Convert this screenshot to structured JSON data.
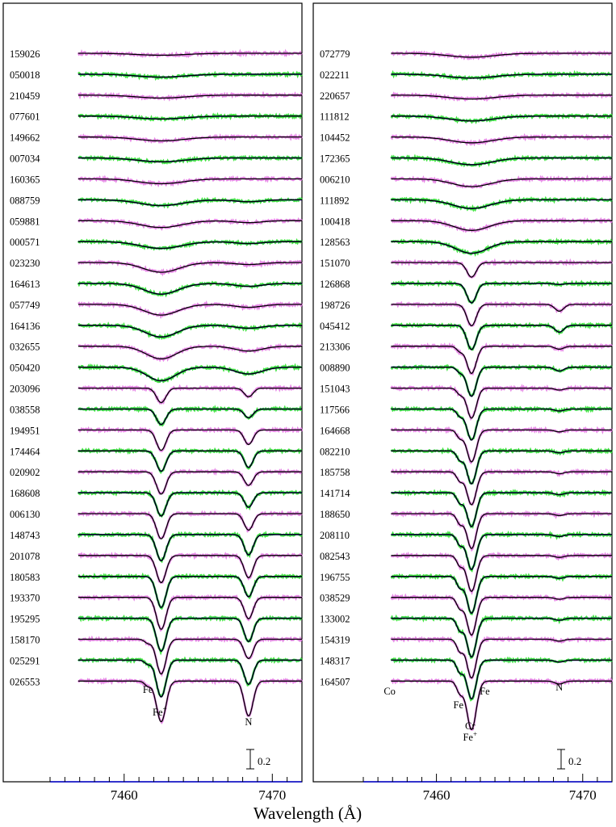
{
  "figure": {
    "xlabel": "Wavelength (Å)",
    "scale_bar_label": "0.2"
  },
  "series_colors": {
    "model": "#000000",
    "model_alt": "#1020c0",
    "observed_a": "#e27ae2",
    "observed_b": "#2ee02e",
    "masked": "#a0a0a0"
  },
  "chart_data": [
    {
      "type": "line",
      "panel": "left",
      "x_range": [
        7455.0,
        7472.0
      ],
      "xticks": [
        7460,
        7470
      ],
      "xtick_labels": [
        "7460",
        "7470"
      ],
      "scale_bar": 0.2,
      "line_labels": [
        {
          "text": "Fe",
          "x": 7461.6
        },
        {
          "text": "Fe",
          "sup": "+",
          "x": 7462.4
        },
        {
          "text": "N",
          "x": 7468.4
        }
      ],
      "stars": [
        {
          "id": "159026",
          "depths": [
            0.0,
            0.02,
            0.0
          ]
        },
        {
          "id": "050018",
          "depths": [
            0.0,
            0.03,
            0.0
          ]
        },
        {
          "id": "210459",
          "depths": [
            0.0,
            0.03,
            0.0
          ]
        },
        {
          "id": "077601",
          "depths": [
            0.0,
            0.03,
            0.0
          ]
        },
        {
          "id": "149662",
          "depths": [
            0.0,
            0.04,
            0.0
          ]
        },
        {
          "id": "007034",
          "depths": [
            0.0,
            0.04,
            0.0
          ]
        },
        {
          "id": "160365",
          "depths": [
            0.0,
            0.05,
            0.0
          ]
        },
        {
          "id": "088759",
          "depths": [
            0.0,
            0.06,
            0.02
          ]
        },
        {
          "id": "059881",
          "depths": [
            0.0,
            0.07,
            0.02
          ]
        },
        {
          "id": "000571",
          "depths": [
            0.0,
            0.07,
            0.02
          ]
        },
        {
          "id": "023230",
          "depths": [
            0.0,
            0.1,
            0.02
          ]
        },
        {
          "id": "164613",
          "depths": [
            0.0,
            0.11,
            0.03
          ]
        },
        {
          "id": "057749",
          "depths": [
            0.0,
            0.11,
            0.03
          ]
        },
        {
          "id": "164136",
          "depths": [
            0.0,
            0.12,
            0.03
          ]
        },
        {
          "id": "032655",
          "depths": [
            0.0,
            0.13,
            0.05
          ]
        },
        {
          "id": "050420",
          "depths": [
            0.0,
            0.14,
            0.07
          ]
        },
        {
          "id": "203096",
          "depths": [
            0.0,
            0.15,
            0.09
          ]
        },
        {
          "id": "038558",
          "depths": [
            0.0,
            0.16,
            0.09
          ]
        },
        {
          "id": "194951",
          "depths": [
            0.0,
            0.21,
            0.15
          ]
        },
        {
          "id": "174464",
          "depths": [
            0.0,
            0.21,
            0.17
          ]
        },
        {
          "id": "020902",
          "depths": [
            0.0,
            0.23,
            0.14
          ]
        },
        {
          "id": "168608",
          "depths": [
            0.0,
            0.24,
            0.15
          ]
        },
        {
          "id": "006130",
          "depths": [
            0.0,
            0.26,
            0.17
          ]
        },
        {
          "id": "148743",
          "depths": [
            0.0,
            0.27,
            0.21
          ]
        },
        {
          "id": "201078",
          "depths": [
            0.0,
            0.28,
            0.23
          ]
        },
        {
          "id": "180583",
          "depths": [
            0.0,
            0.32,
            0.21
          ]
        },
        {
          "id": "193370",
          "depths": [
            0.0,
            0.33,
            0.22
          ]
        },
        {
          "id": "195295",
          "depths": [
            0.0,
            0.34,
            0.24
          ]
        },
        {
          "id": "158170",
          "depths": [
            0.04,
            0.36,
            0.2
          ]
        },
        {
          "id": "025291",
          "depths": [
            0.04,
            0.38,
            0.25
          ]
        },
        {
          "id": "026553",
          "depths": [
            0.05,
            0.42,
            0.36
          ]
        }
      ]
    },
    {
      "type": "line",
      "panel": "right",
      "x_range": [
        7455.0,
        7472.0
      ],
      "xticks": [
        7460,
        7470
      ],
      "xtick_labels": [
        "7460",
        "7470"
      ],
      "scale_bar": 0.2,
      "line_labels": [
        {
          "text": "Co",
          "x": 7456.8
        },
        {
          "text": "Fe",
          "x": 7461.5
        },
        {
          "text": "Cr",
          "x": 7462.3
        },
        {
          "text": "Fe",
          "sup": "+",
          "x": 7462.3
        },
        {
          "text": "Fe",
          "x": 7463.3
        },
        {
          "text": "N",
          "x": 7468.4
        }
      ],
      "stars": [
        {
          "id": "072779",
          "depths": [
            0.0,
            0.04,
            0.0
          ]
        },
        {
          "id": "022211",
          "depths": [
            0.0,
            0.04,
            0.0
          ]
        },
        {
          "id": "220657",
          "depths": [
            0.0,
            0.04,
            0.0
          ]
        },
        {
          "id": "111812",
          "depths": [
            0.0,
            0.05,
            0.0
          ]
        },
        {
          "id": "104452",
          "depths": [
            0.0,
            0.06,
            0.0
          ]
        },
        {
          "id": "172365",
          "depths": [
            0.0,
            0.07,
            0.0
          ]
        },
        {
          "id": "006210",
          "depths": [
            0.0,
            0.08,
            0.0
          ]
        },
        {
          "id": "111892",
          "depths": [
            0.0,
            0.09,
            0.0
          ]
        },
        {
          "id": "100418",
          "depths": [
            0.0,
            0.1,
            0.0
          ]
        },
        {
          "id": "128563",
          "depths": [
            0.0,
            0.12,
            0.0
          ]
        },
        {
          "id": "151070",
          "depths": [
            0.0,
            0.15,
            0.0
          ]
        },
        {
          "id": "126868",
          "depths": [
            0.0,
            0.2,
            0.01
          ]
        },
        {
          "id": "198726",
          "depths": [
            0.0,
            0.22,
            0.07
          ]
        },
        {
          "id": "045412",
          "depths": [
            0.0,
            0.25,
            0.07
          ]
        },
        {
          "id": "213306",
          "depths": [
            0.05,
            0.28,
            0.03
          ]
        },
        {
          "id": "008890",
          "depths": [
            0.05,
            0.3,
            0.04
          ]
        },
        {
          "id": "151043",
          "depths": [
            0.06,
            0.31,
            0.02
          ]
        },
        {
          "id": "117566",
          "depths": [
            0.07,
            0.32,
            0.02
          ]
        },
        {
          "id": "164668",
          "depths": [
            0.08,
            0.33,
            0.02
          ]
        },
        {
          "id": "082210",
          "depths": [
            0.09,
            0.34,
            0.02
          ]
        },
        {
          "id": "185758",
          "depths": [
            0.09,
            0.34,
            0.02
          ]
        },
        {
          "id": "141714",
          "depths": [
            0.1,
            0.35,
            0.02
          ]
        },
        {
          "id": "188650",
          "depths": [
            0.1,
            0.36,
            0.02
          ]
        },
        {
          "id": "208110",
          "depths": [
            0.1,
            0.36,
            0.02
          ]
        },
        {
          "id": "082543",
          "depths": [
            0.1,
            0.37,
            0.02
          ]
        },
        {
          "id": "196755",
          "depths": [
            0.11,
            0.38,
            0.02
          ]
        },
        {
          "id": "038529",
          "depths": [
            0.11,
            0.39,
            0.02
          ]
        },
        {
          "id": "133002",
          "depths": [
            0.12,
            0.4,
            0.02
          ]
        },
        {
          "id": "154319",
          "depths": [
            0.12,
            0.4,
            0.02
          ]
        },
        {
          "id": "148317",
          "depths": [
            0.12,
            0.4,
            0.02
          ]
        },
        {
          "id": "164507",
          "depths": [
            0.12,
            0.5,
            0.03
          ]
        }
      ]
    }
  ]
}
